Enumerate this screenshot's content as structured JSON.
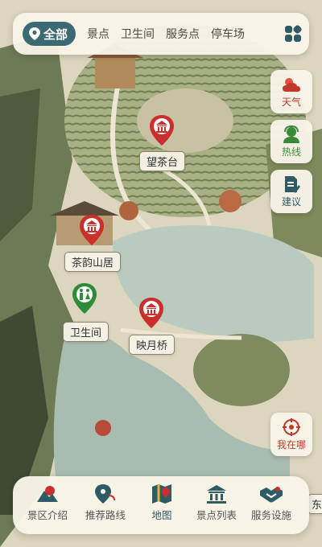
{
  "filters": {
    "all_label": "全部",
    "items": [
      "景点",
      "卫生间",
      "服务点",
      "停车场"
    ]
  },
  "side_tools": [
    {
      "label": "天气",
      "icon": "weather-icon",
      "color": "#c0392b"
    },
    {
      "label": "热线",
      "icon": "hotline-icon",
      "color": "#3a8a3a"
    },
    {
      "label": "建议",
      "icon": "suggestion-icon",
      "color": "#2f5c64"
    }
  ],
  "locate": {
    "label": "我在哪",
    "color": "#c0392b"
  },
  "pois": [
    {
      "name": "望茶台",
      "type": "scenic"
    },
    {
      "name": "茶韵山居",
      "type": "scenic"
    },
    {
      "name": "卫生间",
      "type": "restroom"
    },
    {
      "name": "映月桥",
      "type": "scenic"
    }
  ],
  "offscreen_label": "东",
  "bottom_nav": [
    {
      "label": "景区介绍",
      "icon": "mountain-intro-icon"
    },
    {
      "label": "推荐路线",
      "icon": "route-pin-icon"
    },
    {
      "label": "地图",
      "icon": "map-icon",
      "active": true
    },
    {
      "label": "景点列表",
      "icon": "landmark-list-icon"
    },
    {
      "label": "服务设施",
      "icon": "handshake-service-icon"
    }
  ],
  "colors": {
    "accent": "#3c6a72",
    "marker_red": "#c9302c",
    "marker_green": "#2e8b3a",
    "water": "#b9cbbf",
    "paper": "#dcd6bf"
  }
}
